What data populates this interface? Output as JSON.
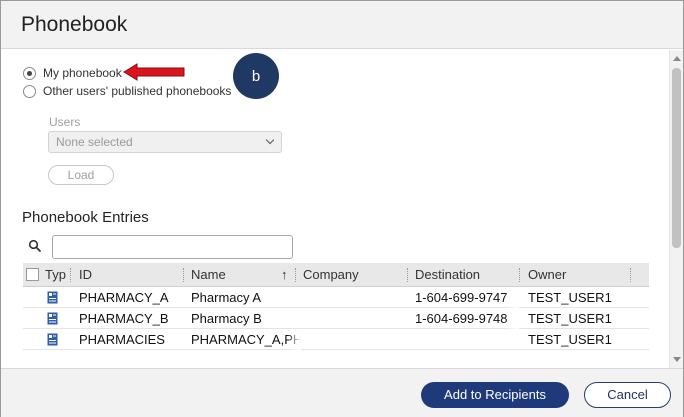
{
  "dialog": {
    "title": "Phonebook"
  },
  "source": {
    "options": [
      {
        "label": "My phonebook",
        "selected": true
      },
      {
        "label": "Other users' published phonebooks",
        "selected": false
      }
    ]
  },
  "annotation": {
    "marker_label": "b",
    "arrow_color": "#d9141c",
    "marker_color": "#1f3864"
  },
  "users": {
    "label": "Users",
    "selected_value": "None selected",
    "load_label": "Load"
  },
  "entries": {
    "title": "Phonebook Entries",
    "search": {
      "value": "",
      "placeholder": ""
    },
    "columns": [
      "Typ",
      "ID",
      "Name",
      "Company",
      "Destination",
      "Owner"
    ],
    "sort": {
      "column": "Name",
      "direction": "ascending"
    },
    "rows": [
      {
        "type_icon": "contact-card-icon",
        "id": "PHARMACY_A",
        "name": "Pharmacy A",
        "company": "",
        "destination": "1-604-699-9747",
        "owner": "TEST_USER1"
      },
      {
        "type_icon": "contact-card-icon",
        "id": "PHARMACY_B",
        "name": "Pharmacy B",
        "company": "",
        "destination": "1-604-699-9748",
        "owner": "TEST_USER1"
      },
      {
        "type_icon": "contact-card-icon",
        "id": "PHARMACIES",
        "name": "PHARMACY_A,PH",
        "company": "",
        "destination": "",
        "owner": "TEST_USER1"
      }
    ]
  },
  "footer": {
    "primary_label": "Add to Recipients",
    "cancel_label": "Cancel"
  },
  "colors": {
    "primary": "#1f3a7a",
    "icon_blue": "#2f5ea8"
  }
}
